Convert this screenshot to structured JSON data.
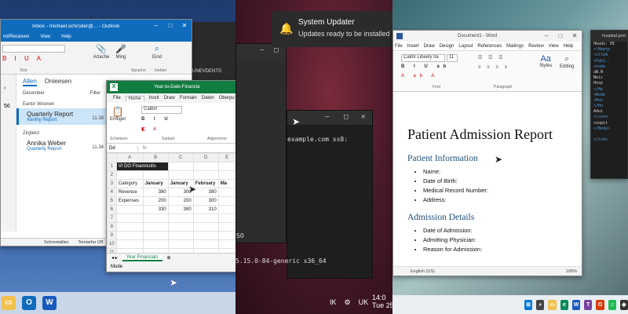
{
  "outlook": {
    "title": "Inbox - michael.schroder@... - Outlook",
    "menu": [
      "nd/Receiven",
      "View",
      "Help"
    ],
    "ribbon": {
      "text_label": "Text",
      "delete_label": "Artache",
      "ming_label": "Ming",
      "find_label": "Eind",
      "find_group": "Sprache",
      "group2": "Ineben"
    },
    "nav_count": "56",
    "tabs": [
      "Allen",
      "Onieesen"
    ],
    "section_label": "December",
    "filter_label": "Filter",
    "section1": "Eartor Woonen",
    "section2": "Zirgleict",
    "emails": [
      {
        "from": "Quarterly Report",
        "subject": "Aanthy Report",
        "time": "11.38"
      },
      {
        "from": "Annika Weber",
        "subject": "Quarterly Report",
        "time": "11.34"
      }
    ],
    "status": [
      "Schrontailles",
      "Temiarfar Off"
    ]
  },
  "background_text": "UNEVDENTS",
  "excel": {
    "title": "Year-to-Date-Financia",
    "menu": [
      "File",
      "Home",
      "Insrit",
      "Draw",
      "Formain",
      "Daten",
      "Oberpu"
    ],
    "font_name": "Calibrl",
    "paste_label": "Enfliger",
    "group_labels": [
      "Schiebere",
      "Sarbart",
      "Aligenmein"
    ],
    "name_box": "Dd",
    "col_headers": [
      "",
      "A",
      "B",
      "C",
      "D",
      "E"
    ],
    "title_cell": "VI DO Finamicolls",
    "rows": [
      [
        "Category",
        "January",
        "January",
        "February",
        "Ma"
      ],
      [
        "Revenue",
        "380",
        "300",
        "380",
        ""
      ],
      [
        "Expenses",
        "200",
        "200",
        "300",
        ""
      ],
      [
        "",
        "330",
        "380",
        "310",
        ""
      ]
    ],
    "sheet_tab": "Year Financials",
    "status": "Mode"
  },
  "ubuntu": {
    "notification_title": "System Updater",
    "notification_body": "Updates ready to be installed",
    "terminal_line1": "example.com xs8:",
    "terminal_line2": "5.15.0-84-generic x36_64",
    "terminal_prefix": "SO",
    "tray": [
      "IK",
      "UK"
    ],
    "clock_time": "14:0",
    "clock_date": "Tue 25"
  },
  "word": {
    "title": "Document1 - Word",
    "menu": [
      "File",
      "Insert",
      "Draw",
      "Design",
      "Layout",
      "References",
      "Mailings",
      "Review",
      "View",
      "Help"
    ],
    "font_name": "Calibr Libeely Ita",
    "font_size": "11",
    "ribbon_groups": [
      "Font",
      "Paragraph"
    ],
    "styles_label": "Styles",
    "editing_label": "Editing",
    "doc_title": "Patient Admission Report",
    "section1_heading": "Patient Information",
    "section1_items": [
      "Name:",
      "Date of Birth:",
      "Medical Record Number:",
      "Address:"
    ],
    "section2_heading": "Admission Details",
    "section2_items": [
      "Date of Admission:",
      "Admitting Physician:",
      "Reason for Admission:"
    ],
    "status_lang": "English (US)",
    "zoom": "100%"
  },
  "code_editor": {
    "title": "hospital.port",
    "lines": [
      "Heado: HI",
      "<!Noptp",
      "  <slleA",
      "  <Fak1..",
      "  <node",
      "    aN.N",
      "     Neic",
      "     Hosp",
      "     </Ho",
      "   <Node",
      "    <Hoo",
      "     </Ho",
      "      Adui",
      "   </cono",
      "   coopit",
      "  </Body>",
      "",
      "  </tobz"
    ]
  }
}
